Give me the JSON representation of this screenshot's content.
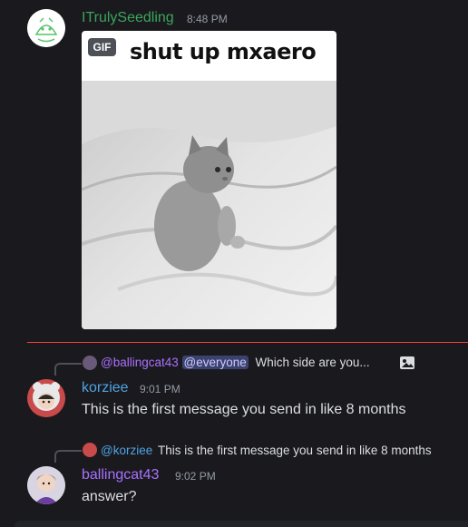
{
  "messages": [
    {
      "author": "ITrulySeedling",
      "time": "8:48 PM",
      "author_color": "#3ba55c",
      "attachment": {
        "badge": "GIF",
        "caption": "shut up mxaero"
      }
    },
    {
      "reply": {
        "mention_user": "@ballingcat43",
        "mention_everyone": "@everyone",
        "text": "Which side are you..."
      },
      "author": "korziee",
      "time": "9:01 PM",
      "author_color": "#4fa3e3",
      "content": "This is the first message you send in like 8 months"
    },
    {
      "reply": {
        "mention_user": "@korziee",
        "text": "This is the first message you send in like 8 months"
      },
      "author": "ballingcat43",
      "time": "9:02 PM",
      "author_color": "#a970ff",
      "content": "answer?"
    }
  ],
  "colors": {
    "background": "#1a1a1e",
    "new_messages_divider": "#f23f42",
    "mention_bg": "#3c4270"
  },
  "icons": [
    "image-icon"
  ]
}
